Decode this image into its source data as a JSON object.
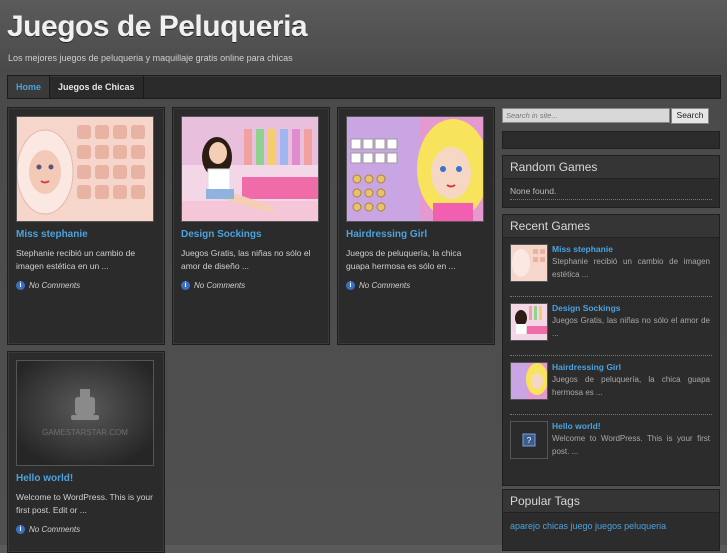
{
  "site": {
    "title": "Juegos de Peluqueria",
    "description": "Los mejores juegos de peluqueria y maquillaje gratis online para chicas"
  },
  "nav": {
    "home": "Home",
    "chicas": "Juegos de Chicas"
  },
  "posts": [
    {
      "title": "Miss stephanie",
      "excerpt": "Stephanie recibió un cambio de imagen estética en un ...",
      "comments": "No Comments"
    },
    {
      "title": "Design Sockings",
      "excerpt": "Juegos Gratis, las niñas no sólo el amor de diseño ...",
      "comments": "No Comments"
    },
    {
      "title": "Hairdressing Girl",
      "excerpt": "Juegos de peluquería, la chica guapa hermosa es sólo en ...",
      "comments": "No Comments"
    },
    {
      "title": "Hello world!",
      "excerpt": "Welcome to WordPress. This is your first post. Edit or ...",
      "comments": "No Comments",
      "thumb_watermark": "GAMESTARSTAR.COM"
    }
  ],
  "sidebar": {
    "search_placeholder": "Search in site...",
    "search_button": "Search",
    "random": {
      "title": "Random Games",
      "empty": "None found."
    },
    "recent": {
      "title": "Recent Games",
      "items": [
        {
          "title": "Miss stephanie",
          "excerpt": "Stephanie recibió un cambio de imagen estética ..."
        },
        {
          "title": "Design Sockings",
          "excerpt": "Juegos Gratis, las niñas no sólo el amor de ..."
        },
        {
          "title": "Hairdressing Girl",
          "excerpt": "Juegos de peluquería, la chica guapa hermosa es ..."
        },
        {
          "title": "Hello world!",
          "excerpt": "Welcome to WordPress. This is your first post. ..."
        }
      ]
    },
    "tags": {
      "title": "Popular Tags",
      "list": "aparejo chicas juego juegos peluqueria"
    }
  },
  "colors": {
    "accent": "#4aa3df",
    "background": "#4d4d4d",
    "panel": "#2b2b2b"
  }
}
